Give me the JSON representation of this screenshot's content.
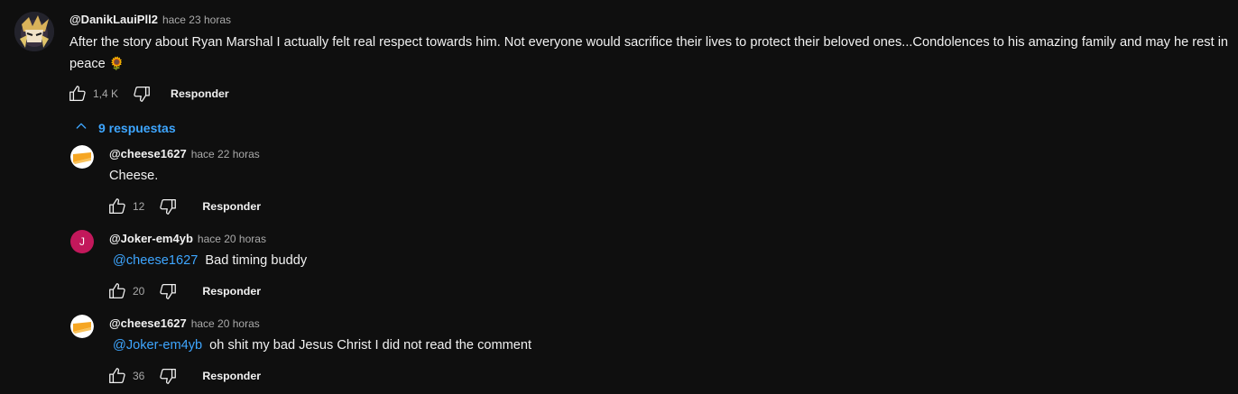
{
  "top_comment": {
    "author": "@DanikLauiPll2",
    "time": "hace 23 horas",
    "text": "After the story about Ryan Marshal I actually felt real respect towards him. Not everyone would sacrifice their lives to protect their beloved ones...Condolences to his amazing family and may he rest in peace",
    "emoji": "🌻",
    "likes": "1,4 K",
    "reply_label": "Responder"
  },
  "replies_toggle": {
    "label": "9 respuestas"
  },
  "replies": [
    {
      "author": "@cheese1627",
      "time": "hace 22 horas",
      "mention": "",
      "text": "Cheese.",
      "likes": "12",
      "reply_label": "Responder"
    },
    {
      "author": "@Joker-em4yb",
      "avatar_letter": "J",
      "time": "hace 20 horas",
      "mention": "@cheese1627",
      "text": "Bad timing buddy",
      "likes": "20",
      "reply_label": "Responder"
    },
    {
      "author": "@cheese1627",
      "time": "hace 20 horas",
      "mention": "@Joker-em4yb",
      "text": "oh shit my bad Jesus Christ I did not read the comment",
      "likes": "36",
      "reply_label": "Responder"
    }
  ],
  "colors": {
    "background": "#0f0f0f",
    "link": "#3ea6ff",
    "secondary_text": "#aaaaaa",
    "avatar_joker": "#c2185b"
  },
  "icons": [
    "thumb-up-icon",
    "thumb-down-icon",
    "chevron-up-icon"
  ]
}
